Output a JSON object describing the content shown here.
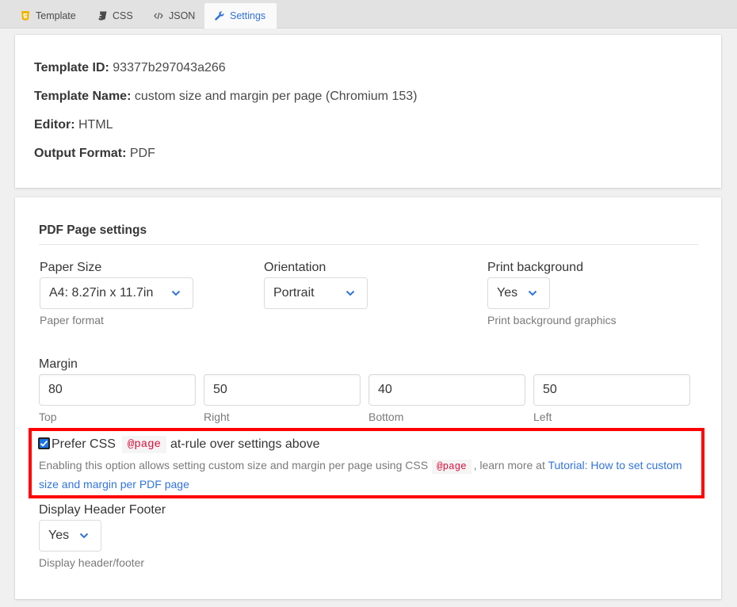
{
  "tabs": [
    {
      "label": "Template",
      "icon": "html5-icon",
      "active": false
    },
    {
      "label": "CSS",
      "icon": "css3-icon",
      "active": false
    },
    {
      "label": "JSON",
      "icon": "code-icon",
      "active": false
    },
    {
      "label": "Settings",
      "icon": "wrench-icon",
      "active": true
    }
  ],
  "info": {
    "template_id_label": "Template ID:",
    "template_id": "93377b297043a266",
    "template_name_label": "Template Name:",
    "template_name": "custom size and margin per page (Chromium 153)",
    "editor_label": "Editor:",
    "editor": "HTML",
    "output_format_label": "Output Format:",
    "output_format": "PDF"
  },
  "pdf_settings": {
    "title": "PDF Page settings",
    "paper_size": {
      "label": "Paper Size",
      "value": "A4: 8.27in x 11.7in",
      "help": "Paper format"
    },
    "orientation": {
      "label": "Orientation",
      "value": "Portrait"
    },
    "print_background": {
      "label": "Print background",
      "value": "Yes",
      "help": "Print background graphics"
    },
    "margin": {
      "label": "Margin",
      "top": {
        "value": "80",
        "caption": "Top"
      },
      "right": {
        "value": "50",
        "caption": "Right"
      },
      "bottom": {
        "value": "40",
        "caption": "Bottom"
      },
      "left": {
        "value": "50",
        "caption": "Left"
      }
    },
    "prefer_css": {
      "checked": true,
      "label_before": "Prefer CSS",
      "code": "@page",
      "label_after": "at-rule over settings above",
      "help_before": "Enabling this option allows setting custom size and margin per page using CSS",
      "help_code": "@page",
      "help_middle": ", learn more at",
      "link_text": "Tutorial: How to set custom size and margin per PDF page"
    },
    "header_footer": {
      "label": "Display Header Footer",
      "value": "Yes",
      "help": "Display header/footer"
    }
  },
  "colors": {
    "accent": "#3273dc",
    "highlight": "#ff0000",
    "code": "#da1039"
  }
}
